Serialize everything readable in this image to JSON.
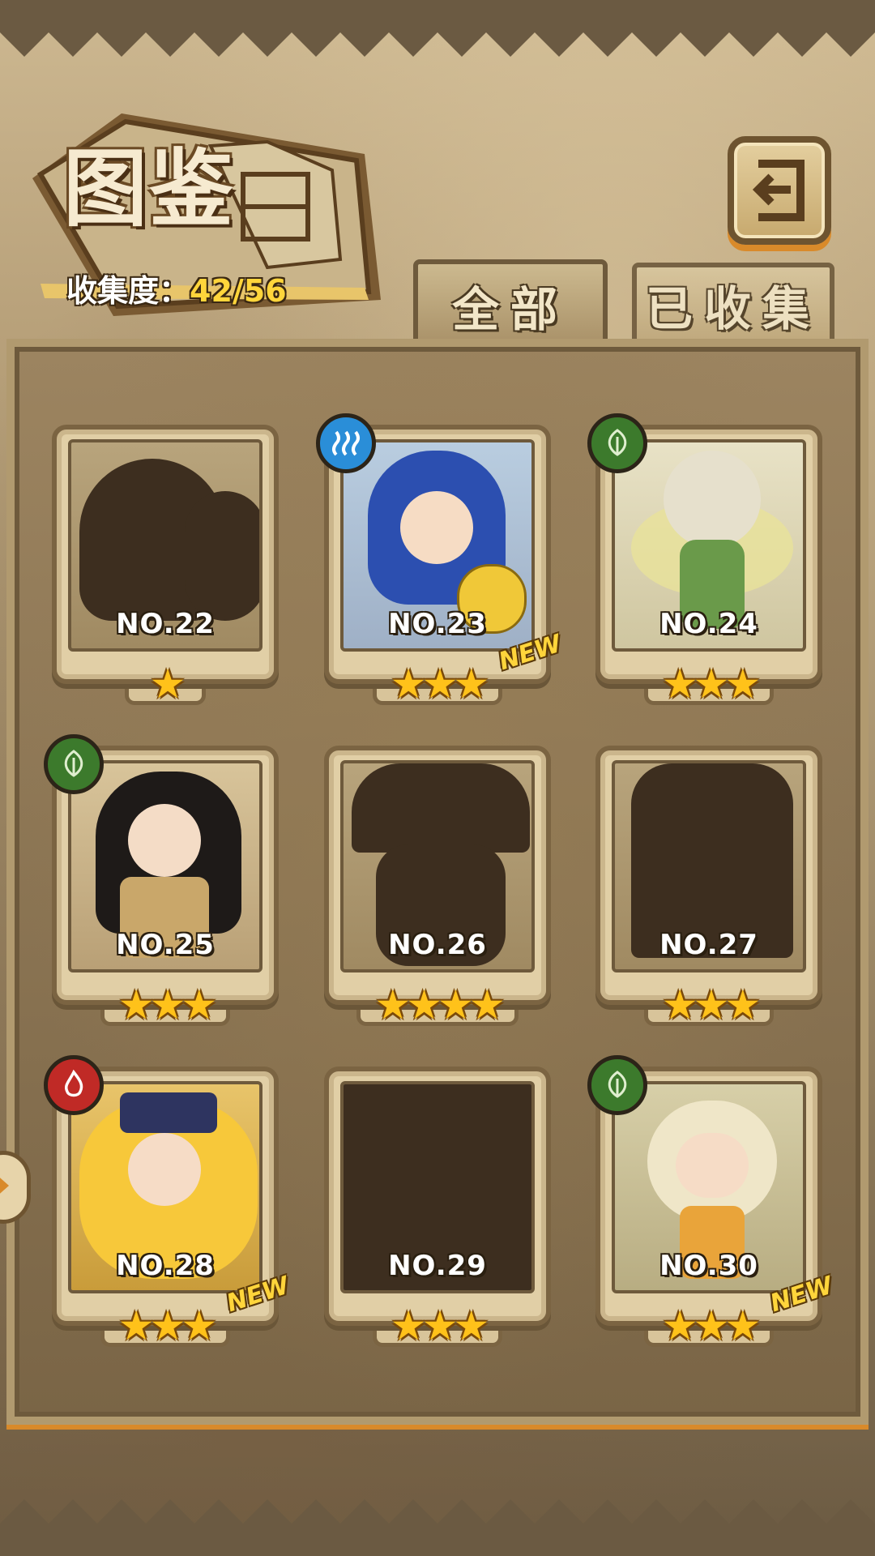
{
  "header": {
    "title": "图鉴",
    "collection_label": "收集度：",
    "collection_value": "42/56"
  },
  "tabs": [
    {
      "label": "全部",
      "active": true
    },
    {
      "label": "已收集",
      "active": false
    }
  ],
  "colors": {
    "accent_orange": "#d98a2a",
    "star": "#ffc21a",
    "count": "#ffd53b",
    "silhouette": "#3d2e1f"
  },
  "cards": [
    {
      "number": "NO.22",
      "stars": "★",
      "unlocked": false,
      "element": null,
      "is_new": false
    },
    {
      "number": "NO.23",
      "stars": "★★★",
      "unlocked": true,
      "element": "water-icon",
      "is_new": true,
      "new_label": "NEW"
    },
    {
      "number": "NO.24",
      "stars": "★★★",
      "unlocked": true,
      "element": "leaf-icon",
      "is_new": false
    },
    {
      "number": "NO.25",
      "stars": "★★★",
      "unlocked": true,
      "element": "leaf-icon",
      "is_new": false
    },
    {
      "number": "NO.26",
      "stars": "★★★★",
      "unlocked": false,
      "element": null,
      "is_new": false
    },
    {
      "number": "NO.27",
      "stars": "★★★",
      "unlocked": false,
      "element": null,
      "is_new": false
    },
    {
      "number": "NO.28",
      "stars": "★★★",
      "unlocked": true,
      "element": "fire-icon",
      "is_new": true,
      "new_label": "NEW"
    },
    {
      "number": "NO.29",
      "stars": "★★★",
      "unlocked": false,
      "element": null,
      "is_new": false
    },
    {
      "number": "NO.30",
      "stars": "★★★",
      "unlocked": true,
      "element": "leaf-icon",
      "is_new": true,
      "new_label": "NEW"
    }
  ]
}
